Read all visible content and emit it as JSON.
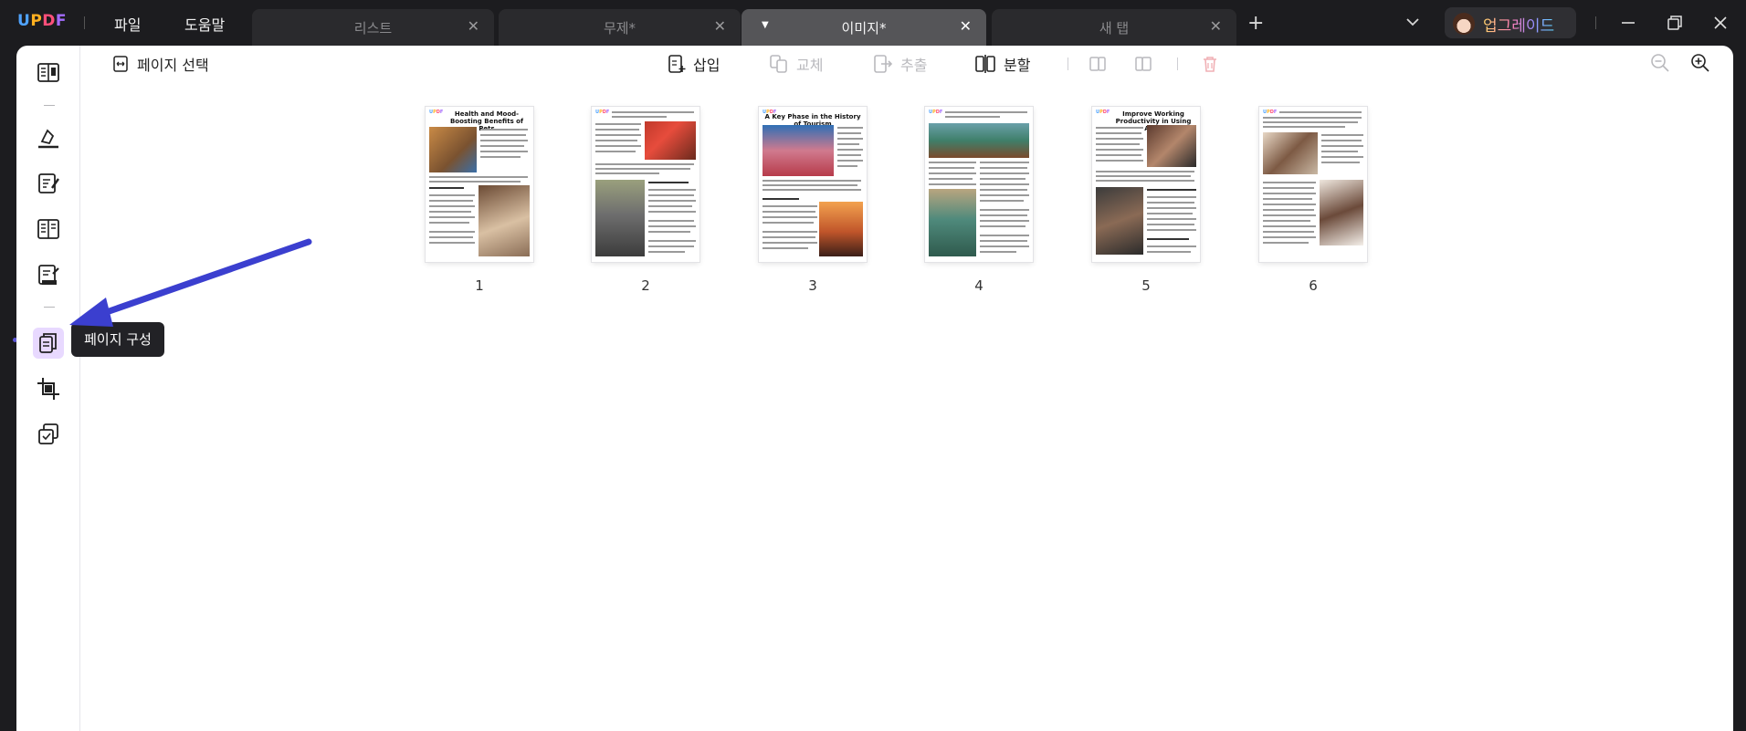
{
  "app": {
    "logo": "UPDF"
  },
  "menu": {
    "file": "파일",
    "help": "도움말"
  },
  "tabs": [
    {
      "label": "리스트",
      "active": false
    },
    {
      "label": "무제*",
      "active": false
    },
    {
      "label": "이미지*",
      "active": true
    },
    {
      "label": "새 탭",
      "active": false
    }
  ],
  "upgrade": {
    "label": "업그레이드"
  },
  "toolbar": {
    "page_select": "페이지 선택",
    "insert": "삽입",
    "replace": "교체",
    "extract": "추출",
    "split": "분할"
  },
  "pages": [
    {
      "number": "1",
      "title": "Health and Mood-Boosting Benefits of Pets"
    },
    {
      "number": "2",
      "title": ""
    },
    {
      "number": "3",
      "title": "A Key Phase in the History of Tourism"
    },
    {
      "number": "4",
      "title": ""
    },
    {
      "number": "5",
      "title": "Improve Working Productivity in Using Apps"
    },
    {
      "number": "6",
      "title": ""
    }
  ],
  "tooltip": {
    "text": "페이지 구성"
  },
  "colors": {
    "accent": "#5d56d6",
    "arrow": "#3b3fcf",
    "active_bg": "#e8d9ff"
  }
}
